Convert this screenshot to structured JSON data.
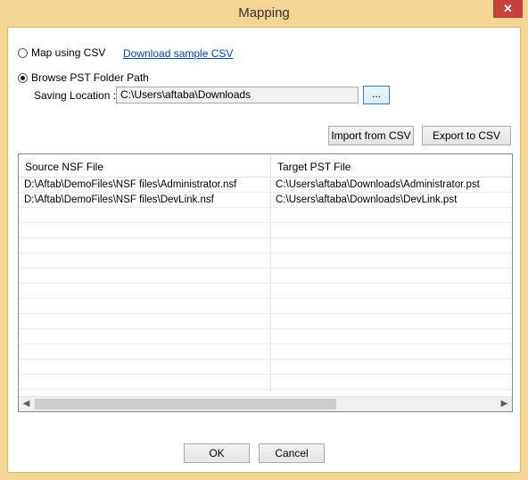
{
  "window": {
    "title": "Mapping",
    "close_label": "✕"
  },
  "options": {
    "map_csv_label": "Map using CSV",
    "download_link": "Download sample CSV",
    "browse_label": "Browse PST Folder Path",
    "saving_label": "Saving Location :",
    "saving_path": "C:\\Users\\aftaba\\Downloads",
    "browse_button": "...",
    "selected": "browse"
  },
  "toolbar": {
    "import_label": "Import from CSV",
    "export_label": "Export to CSV"
  },
  "table": {
    "columns": [
      "Source NSF File",
      "Target PST File"
    ],
    "rows": [
      [
        "D:\\Aftab\\DemoFiles\\NSF files\\Administrator.nsf",
        "C:\\Users\\aftaba\\Downloads\\Administrator.pst"
      ],
      [
        "D:\\Aftab\\DemoFiles\\NSF files\\DevLink.nsf",
        "C:\\Users\\aftaba\\Downloads\\DevLink.pst"
      ],
      [
        "",
        ""
      ],
      [
        "",
        ""
      ],
      [
        "",
        ""
      ],
      [
        "",
        ""
      ],
      [
        "",
        ""
      ],
      [
        "",
        ""
      ],
      [
        "",
        ""
      ],
      [
        "",
        ""
      ],
      [
        "",
        ""
      ],
      [
        "",
        ""
      ],
      [
        "",
        ""
      ],
      [
        "",
        ""
      ],
      [
        "",
        ""
      ]
    ]
  },
  "footer": {
    "ok_label": "OK",
    "cancel_label": "Cancel"
  },
  "colors": {
    "frame": "#f5d593",
    "close": "#c7403a",
    "link": "#0645ad"
  }
}
